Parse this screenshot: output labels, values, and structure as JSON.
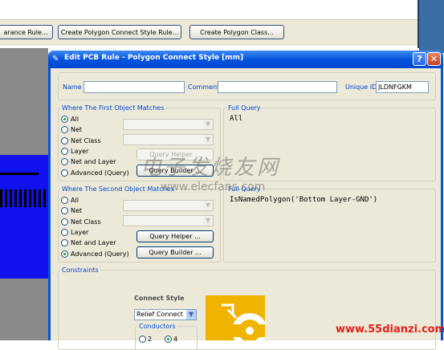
{
  "background_app": {
    "buttons": [
      {
        "label": "arance Rule..."
      },
      {
        "label": "Create Polygon Connect Style Rule..."
      },
      {
        "label": "Create Polygon Class..."
      }
    ]
  },
  "dialog": {
    "title": "Edit PCB Rule - Polygon Connect Style [mm]",
    "name_label": "Name",
    "name_value": "",
    "comment_label": "Comment",
    "comment_value": "",
    "unique_id_label": "Unique ID",
    "unique_id_value": "JLDNFGKM",
    "first_match": {
      "title": "Where The First Object Matches",
      "options": [
        "All",
        "Net",
        "Net Class",
        "Layer",
        "Net and Layer",
        "Advanced (Query)"
      ],
      "selected": "All",
      "query_helper_label": "Query Helper ...",
      "query_builder_label": "Query Builder ..."
    },
    "full_query_1": {
      "title": "Full Query",
      "text": "All"
    },
    "second_match": {
      "title": "Where The Second Object Matches",
      "options": [
        "All",
        "Net",
        "Net Class",
        "Layer",
        "Net and Layer",
        "Advanced (Query)"
      ],
      "selected": "Advanced (Query)",
      "query_helper_label": "Query Helper ...",
      "query_builder_label": "Query Builder ..."
    },
    "full_query_2": {
      "title": "Full Query",
      "text": "IsNamedPolygon('Bottom Layer-GND')"
    },
    "constraints": {
      "title": "Constraints",
      "connect_style_label": "Connect Style",
      "connect_style_value": "Relief Connect",
      "conductors_label": "Conductors",
      "conductor_options": [
        "2",
        "4"
      ],
      "selected_conductors": "4"
    }
  },
  "watermarks": {
    "cn_text": "电子发烧友网",
    "site1": "www.elecfans.com",
    "site2": "www.55dianzi.com"
  },
  "colors": {
    "title_bar": "#0653dc",
    "dialog_face": "#ece9d8",
    "group_title": "#0046d5",
    "pcb_blue": "#1111ee",
    "thermal_pad": "#f0b400"
  }
}
